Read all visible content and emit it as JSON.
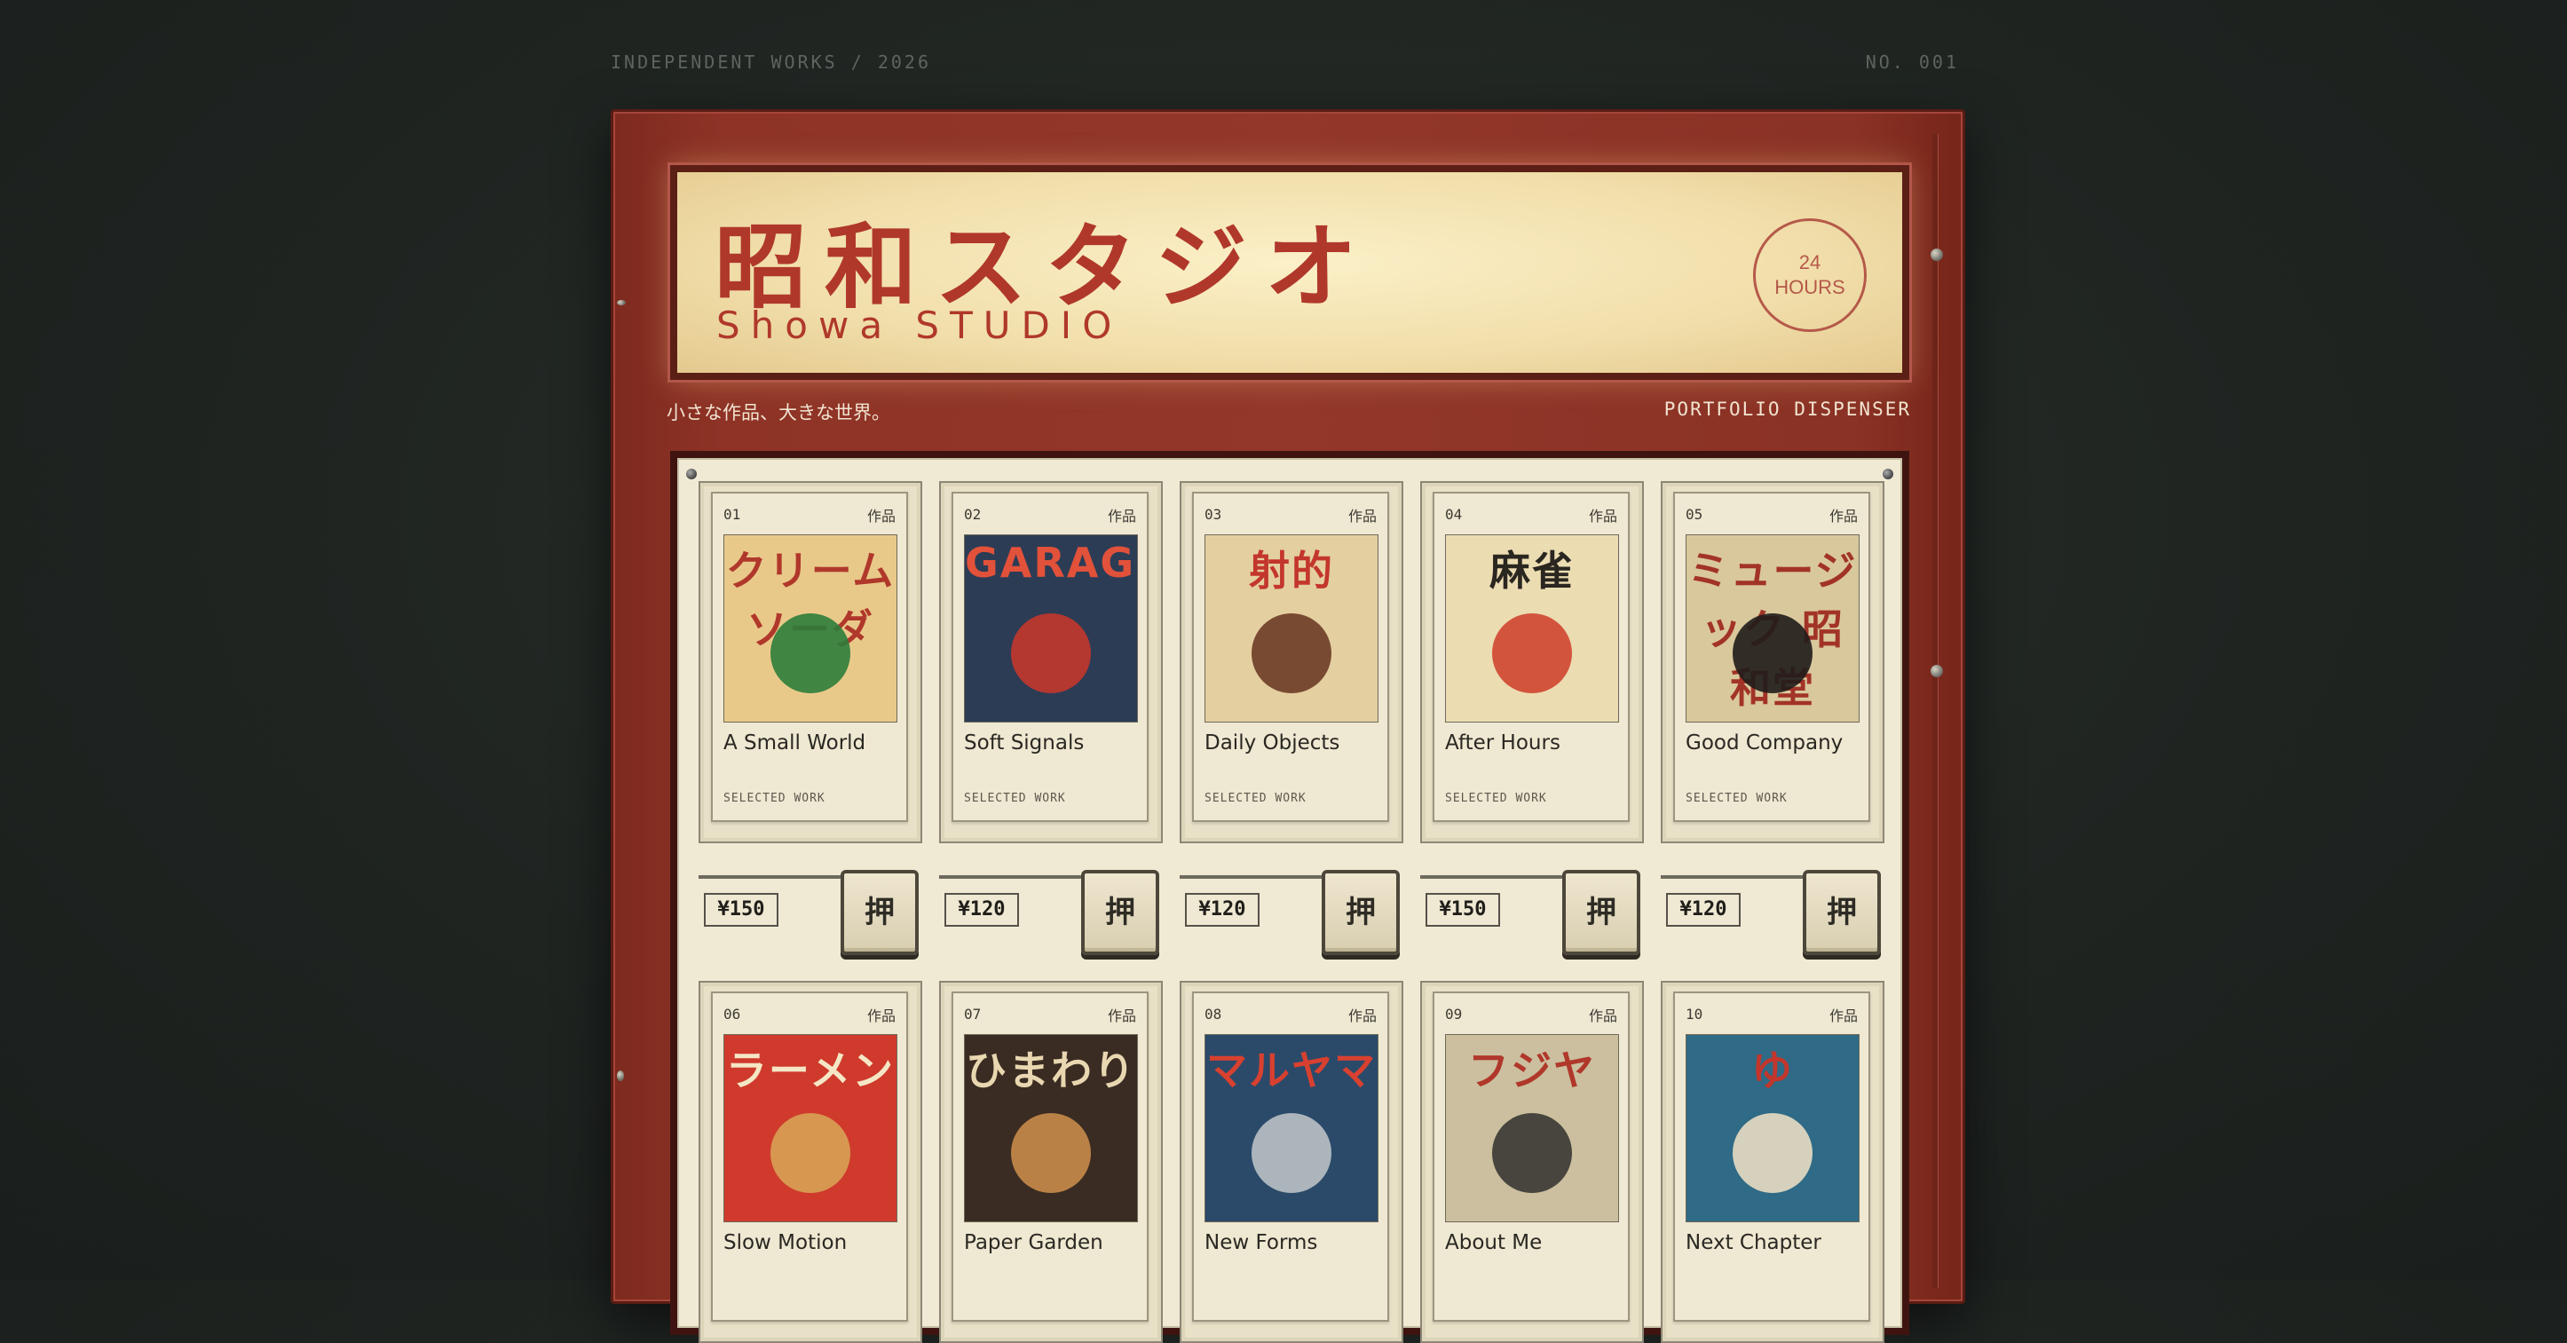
{
  "header": {
    "left": "INDEPENDENT WORKS / 2026",
    "right": "NO. 001"
  },
  "marquee": {
    "title_jp": "昭和スタジオ",
    "title_en": "Showa STUDIO",
    "badge_num": "24",
    "badge_label": "HOURS"
  },
  "tagline": "小さな作品、大きな世界。",
  "dispenser_label": "PORTFOLIO DISPENSER",
  "push_label": "押",
  "colors": {
    "body_red": "#8e3326",
    "marquee_cream": "#f1deaa",
    "title_red": "#b0382b",
    "backdrop": "#1f2421"
  },
  "items": [
    {
      "num": "01",
      "kind": "作品",
      "title": "A Small World",
      "sub": "SELECTED WORK",
      "price": "¥150",
      "art_text": "クリームソーダ",
      "art_bg": "#e9c98a",
      "art_fg": "#b0382b",
      "accent": "#2e7d3a"
    },
    {
      "num": "02",
      "kind": "作品",
      "title": "Soft Signals",
      "sub": "SELECTED WORK",
      "price": "¥120",
      "art_text": "GARAGE",
      "art_bg": "#2c3c55",
      "art_fg": "#e2513a",
      "accent": "#c3362c"
    },
    {
      "num": "03",
      "kind": "作品",
      "title": "Daily Objects",
      "sub": "SELECTED WORK",
      "price": "¥120",
      "art_text": "射的",
      "art_bg": "#e4cfa0",
      "art_fg": "#c3362c",
      "accent": "#6d3b26"
    },
    {
      "num": "04",
      "kind": "作品",
      "title": "After Hours",
      "sub": "SELECTED WORK",
      "price": "¥150",
      "art_text": "麻雀",
      "art_bg": "#ecdcb2",
      "art_fg": "#2a2620",
      "accent": "#d0452f"
    },
    {
      "num": "05",
      "kind": "作品",
      "title": "Good Company",
      "sub": "SELECTED WORK",
      "price": "¥120",
      "art_text": "ミュージック 昭和堂",
      "art_bg": "#d9c89c",
      "art_fg": "#a23328",
      "accent": "#1e1c1a"
    },
    {
      "num": "06",
      "kind": "作品",
      "title": "Slow Motion",
      "sub": "",
      "price": "",
      "art_text": "ラーメン",
      "art_bg": "#cf3a2c",
      "art_fg": "#f5e7c6",
      "accent": "#d8a255"
    },
    {
      "num": "07",
      "kind": "作品",
      "title": "Paper Garden",
      "sub": "",
      "price": "",
      "art_text": "ひまわり",
      "art_bg": "#3a2c22",
      "art_fg": "#e8d7b0",
      "accent": "#c98b4a"
    },
    {
      "num": "08",
      "kind": "作品",
      "title": "New Forms",
      "sub": "",
      "price": "",
      "art_text": "マルヤマ",
      "art_bg": "#2b4a6a",
      "art_fg": "#d8402f",
      "accent": "#b9c1c4"
    },
    {
      "num": "09",
      "kind": "作品",
      "title": "About Me",
      "sub": "",
      "price": "",
      "art_text": "フジヤ",
      "art_bg": "#cbbf9f",
      "art_fg": "#b0382b",
      "accent": "#3a3733"
    },
    {
      "num": "10",
      "kind": "作品",
      "title": "Next Chapter",
      "sub": "",
      "price": "",
      "art_text": "ゆ",
      "art_bg": "#2f6a86",
      "art_fg": "#c3362c",
      "accent": "#e8ddc2"
    }
  ]
}
